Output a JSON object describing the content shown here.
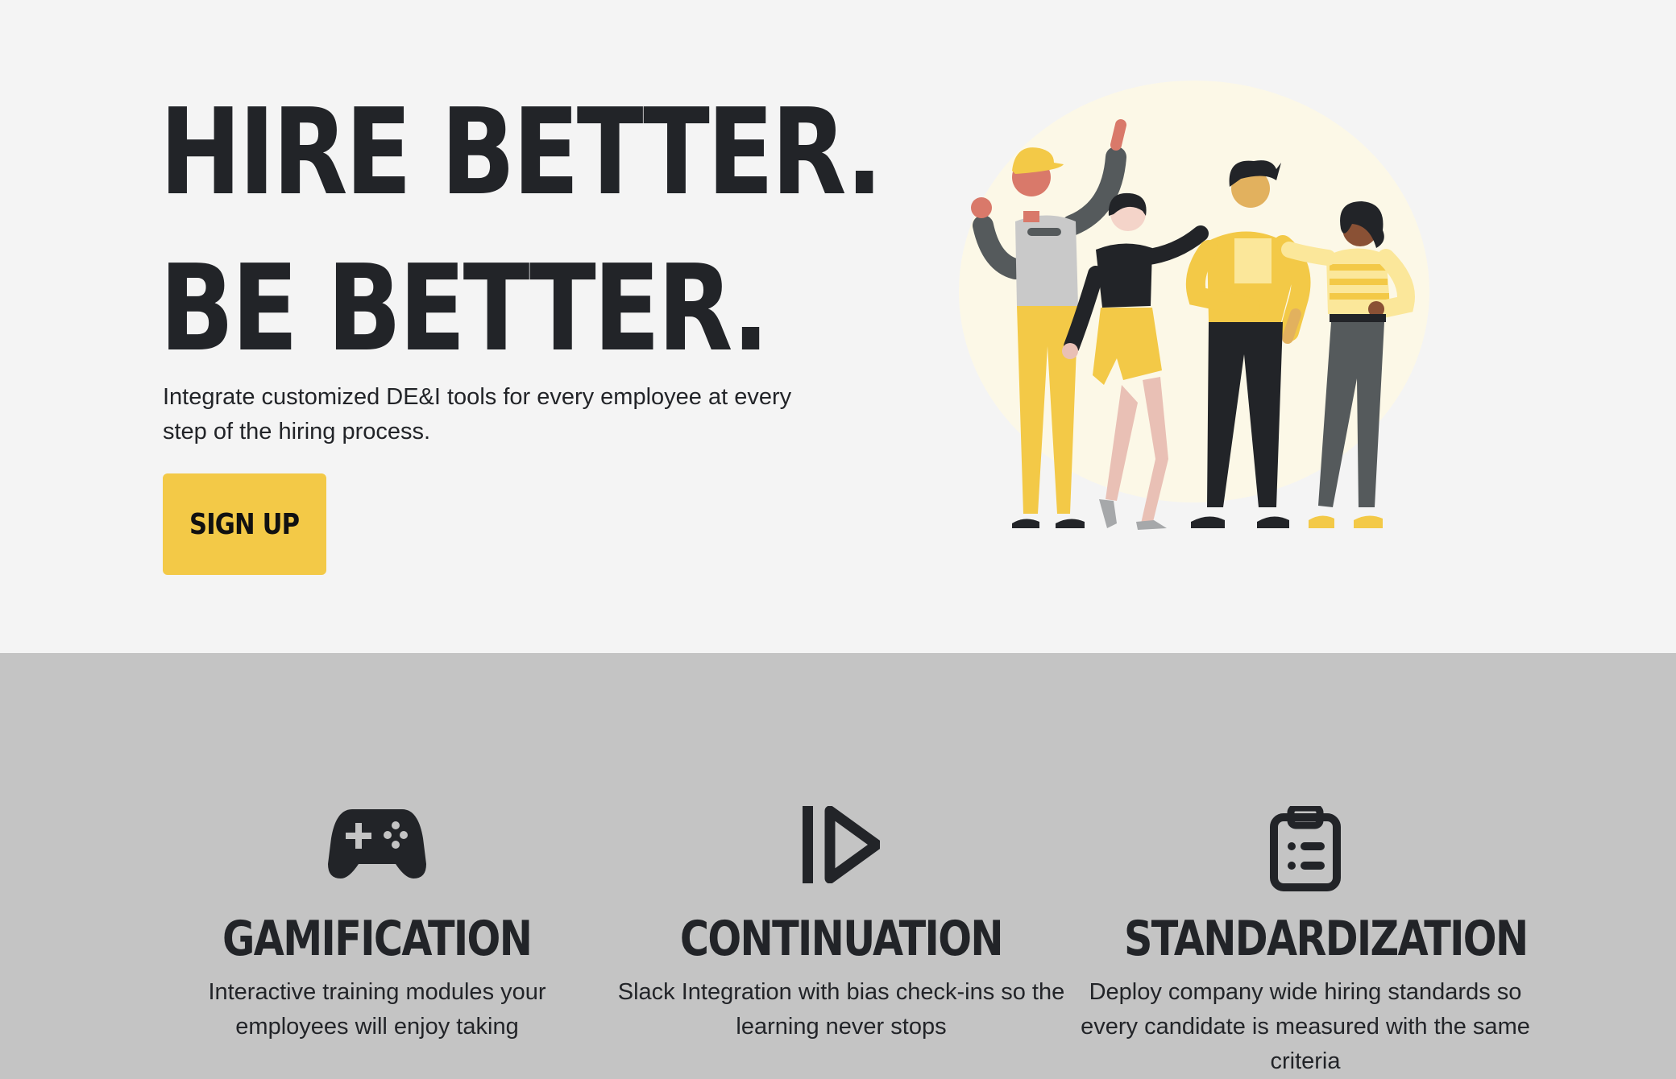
{
  "hero": {
    "headline_line1": "HIRE BETTER.",
    "headline_line2": "BE BETTER.",
    "subtitle": "Integrate customized DE&I tools for every employee at every step of the hiring process.",
    "signup_label": "SIGN UP",
    "illustration": "group-of-four-people-illustration"
  },
  "features": [
    {
      "icon": "gamepad-icon",
      "title": "GAMIFICATION",
      "description": "Interactive training modules your employees will enjoy taking"
    },
    {
      "icon": "play-step-icon",
      "title": "CONTINUATION",
      "description": "Slack Integration with bias check-ins so the learning never stops"
    },
    {
      "icon": "clipboard-list-icon",
      "title": "STANDARDIZATION",
      "description": "Deploy company wide hiring standards so every candidate is measured with the same criteria"
    }
  ],
  "colors": {
    "hero_bg": "#f4f4f4",
    "features_bg": "#c4c4c4",
    "accent": "#f3c947",
    "text": "#222428"
  }
}
